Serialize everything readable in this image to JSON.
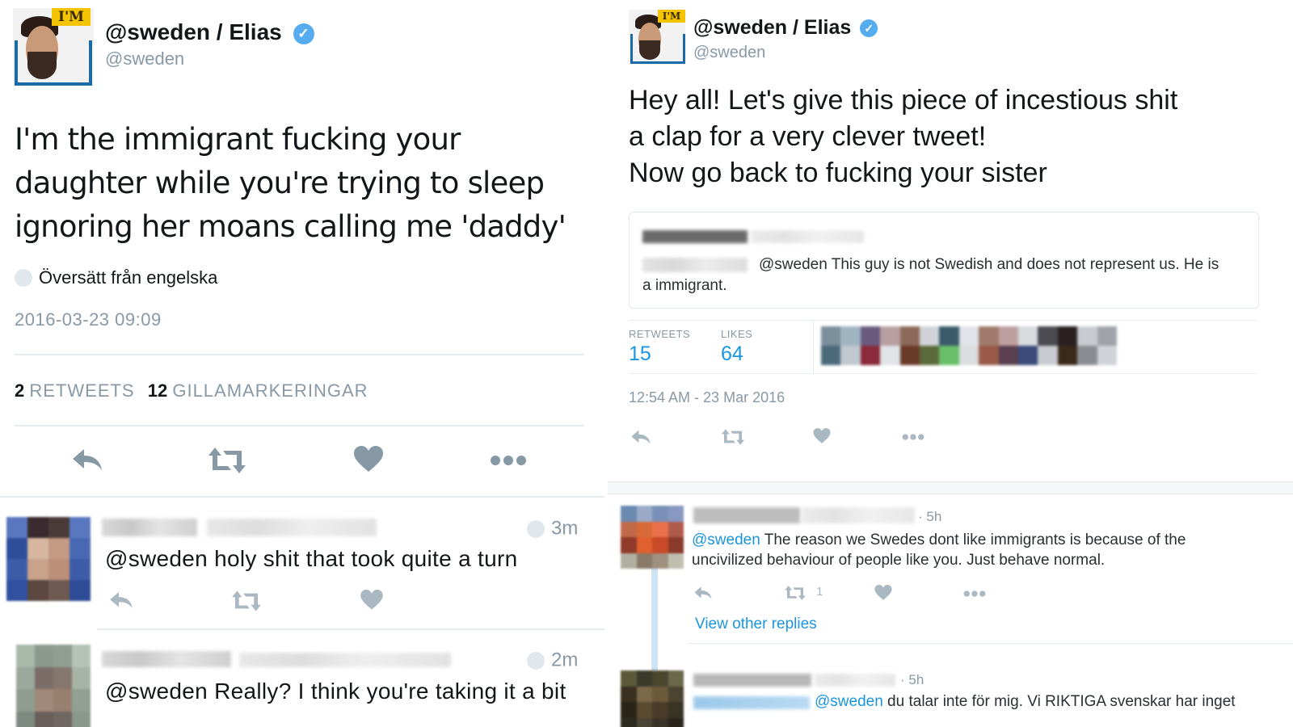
{
  "left": {
    "display_name": "@sweden / Elias",
    "handle": "@sweden",
    "badge": "I'M",
    "tweet_text": "I'm the immigrant fucking your daughter while you're trying to sleep ignoring her moans calling me 'daddy'",
    "translate_label": "Översätt från engelska",
    "timestamp": "2016-03-23 09:09",
    "retweets_count": "2",
    "retweets_label": "RETWEETS",
    "likes_count": "12",
    "likes_label": "GILLAMARKERINGAR",
    "replies": [
      {
        "time": "3m",
        "text": "@sweden holy shit that took quite a turn"
      },
      {
        "time": "2m",
        "text": "@sweden Really? I think you're taking it a bit"
      }
    ]
  },
  "right": {
    "display_name": "@sweden / Elias",
    "handle": "@sweden",
    "badge": "I'M",
    "tweet_line1": "Hey all! Let's give this piece of incestious shit",
    "tweet_line2": "a clap for a very clever tweet!",
    "tweet_line3": "Now go back to fucking your sister",
    "quoted_text_line1": "@sweden This guy is not Swedish and does not represent us. He is",
    "quoted_text_line2": "a immigrant.",
    "retweets_label": "RETWEETS",
    "retweets_count": "15",
    "likes_label": "LIKES",
    "likes_count": "64",
    "timestamp": "12:54 AM - 23 Mar 2016",
    "replies": [
      {
        "time": "· 5h",
        "mention": "@sweden",
        "text_line1": " The reason we Swedes dont like immigrants is because of the",
        "text_line2": "uncivilized behaviour of people like you.  Just behave normal.",
        "retweet_count": "1"
      },
      {
        "time": "· 5h",
        "mention": "@sweden",
        "text_line1": " du talar inte för mig. Vi RIKTIGA svenskar har inget"
      }
    ],
    "view_other_replies": "View other replies"
  },
  "colors": {
    "accent_blue": "#1b95e0",
    "verified_blue": "#55acee",
    "gray_text": "#8899a6",
    "divider": "#e6ecf0"
  },
  "icons": [
    "reply-icon",
    "retweet-icon",
    "like-icon",
    "more-icon",
    "globe-icon",
    "verified-icon"
  ]
}
